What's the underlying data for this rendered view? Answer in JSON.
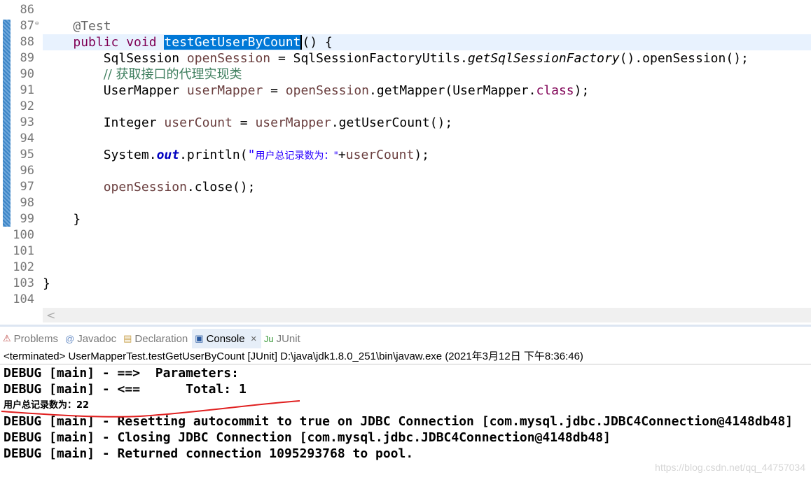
{
  "editor": {
    "lines": [
      {
        "n": "86",
        "tokens": []
      },
      {
        "n": "87",
        "fold": true,
        "tokens": [
          [
            "    ",
            ""
          ],
          [
            "@Test",
            "ann"
          ]
        ]
      },
      {
        "n": "88",
        "current": true,
        "tokens": [
          [
            "    ",
            ""
          ],
          [
            "public void ",
            "kw"
          ],
          [
            "testGetUserByCount",
            "sel"
          ],
          [
            "() {",
            ""
          ]
        ]
      },
      {
        "n": "89",
        "tokens": [
          [
            "        SqlSession ",
            ""
          ],
          [
            "openSession",
            "var"
          ],
          [
            " = SqlSessionFactoryUtils.",
            ""
          ],
          [
            "getSqlSessionFactory",
            "st"
          ],
          [
            "().openSession();",
            ""
          ]
        ]
      },
      {
        "n": "90",
        "tokens": [
          [
            "        ",
            ""
          ],
          [
            "// 获取接口的代理实现类",
            "cm"
          ]
        ]
      },
      {
        "n": "91",
        "tokens": [
          [
            "        UserMapper ",
            ""
          ],
          [
            "userMapper",
            "var"
          ],
          [
            " = ",
            ""
          ],
          [
            "openSession",
            "var"
          ],
          [
            ".getMapper(UserMapper.",
            ""
          ],
          [
            "class",
            "kw"
          ],
          [
            ");",
            ""
          ]
        ]
      },
      {
        "n": "92",
        "tokens": []
      },
      {
        "n": "93",
        "tokens": [
          [
            "        Integer ",
            ""
          ],
          [
            "userCount",
            "var"
          ],
          [
            " = ",
            ""
          ],
          [
            "userMapper",
            "var"
          ],
          [
            ".getUserCount();",
            ""
          ]
        ]
      },
      {
        "n": "94",
        "tokens": []
      },
      {
        "n": "95",
        "tokens": [
          [
            "        System.",
            ""
          ],
          [
            "out",
            "fld"
          ],
          [
            ".println(",
            ""
          ],
          [
            "\"",
            "str"
          ],
          [
            "用户总记录数为：\"",
            "strz"
          ],
          [
            "+",
            ""
          ],
          [
            "userCount",
            "var"
          ],
          [
            ");",
            ""
          ]
        ]
      },
      {
        "n": "96",
        "tokens": []
      },
      {
        "n": "97",
        "tokens": [
          [
            "        ",
            ""
          ],
          [
            "openSession",
            "var"
          ],
          [
            ".close();",
            ""
          ]
        ]
      },
      {
        "n": "98",
        "tokens": []
      },
      {
        "n": "99",
        "tokens": [
          [
            "    }",
            ""
          ]
        ]
      },
      {
        "n": "100",
        "tokens": []
      },
      {
        "n": "101",
        "tokens": []
      },
      {
        "n": "102",
        "tokens": []
      },
      {
        "n": "103",
        "tokens": [
          [
            "}",
            ""
          ]
        ]
      },
      {
        "n": "104",
        "tokens": []
      }
    ],
    "scroll_left": "<"
  },
  "tabs": [
    {
      "label": "Problems",
      "icon": "problems-icon",
      "glyph": "⚠",
      "color": "#c0504d"
    },
    {
      "label": "Javadoc",
      "icon": "at-icon",
      "glyph": "@",
      "color": "#6a8fc7"
    },
    {
      "label": "Declaration",
      "icon": "declaration-icon",
      "glyph": "▤",
      "color": "#c9a24d"
    },
    {
      "label": "Console",
      "icon": "console-icon",
      "glyph": "▣",
      "color": "#2a5aa0",
      "active": true,
      "close": "✕"
    },
    {
      "label": "JUnit",
      "icon": "junit-icon",
      "glyph": "Ju",
      "color": "#3a9a3a"
    }
  ],
  "console": {
    "header": "<terminated> UserMapperTest.testGetUserByCount [JUnit] D:\\java\\jdk1.8.0_251\\bin\\javaw.exe (2021年3月12日 下午8:36:46)",
    "lines": [
      {
        "text": "DEBUG [main] - ==>  Parameters: "
      },
      {
        "text": "DEBUG [main] - <==      Total: 1"
      },
      {
        "text": "用户总记录数为：22",
        "zh": true
      },
      {
        "text": "DEBUG [main] - Resetting autocommit to true on JDBC Connection [com.mysql.jdbc.JDBC4Connection@4148db48]"
      },
      {
        "text": "DEBUG [main] - Closing JDBC Connection [com.mysql.jdbc.JDBC4Connection@4148db48]"
      },
      {
        "text": "DEBUG [main] - Returned connection 1095293768 to pool."
      }
    ]
  },
  "watermark": "https://blog.csdn.net/qq_44757034",
  "colors": {
    "keyword": "#7f0055",
    "selection": "#0078d7",
    "annotation_underline": "#e02020"
  }
}
